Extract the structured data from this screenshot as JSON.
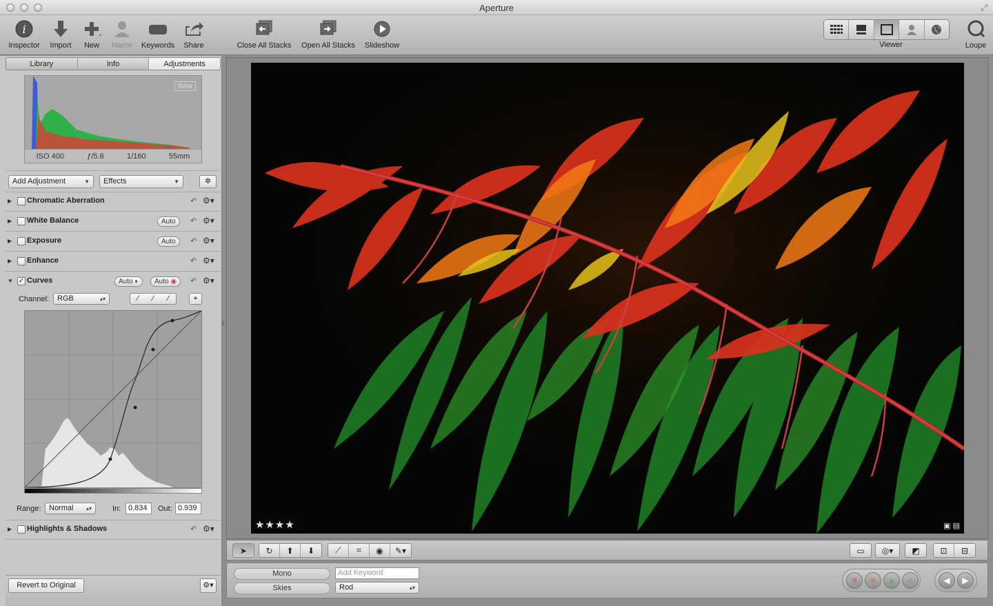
{
  "window": {
    "title": "Aperture"
  },
  "toolbar": {
    "inspector": "Inspector",
    "import": "Import",
    "new": "New",
    "name": "Name",
    "keywords": "Keywords",
    "share": "Share",
    "close_all_stacks": "Close All Stacks",
    "open_all_stacks": "Open All Stacks",
    "slideshow": "Slideshow",
    "viewer": "Viewer",
    "loupe": "Loupe"
  },
  "inspector": {
    "tabs": [
      {
        "label": "Library"
      },
      {
        "label": "Info"
      },
      {
        "label": "Adjustments"
      }
    ],
    "histogram": {
      "badge": "RAW",
      "iso": "ISO 400",
      "aperture": "ƒ/5.6",
      "shutter": "1/160",
      "focal": "55mm"
    },
    "add_adjustment": "Add Adjustment",
    "effects": "Effects",
    "adjustments": [
      {
        "label": "Chromatic Aberration"
      },
      {
        "label": "White Balance",
        "auto": "Auto"
      },
      {
        "label": "Exposure",
        "auto": "Auto"
      },
      {
        "label": "Enhance"
      },
      {
        "label": "Curves",
        "auto1": "Auto",
        "auto2": "Auto"
      }
    ],
    "curves": {
      "channel_label": "Channel:",
      "channel_value": "RGB",
      "range_label": "Range:",
      "range_value": "Normal",
      "in_label": "In:",
      "in_value": "0.834",
      "out_label": "Out:",
      "out_value": "0.939"
    },
    "highlights_shadows": "Highlights & Shadows",
    "revert": "Revert to Original"
  },
  "photo": {
    "stars": "★★★★"
  },
  "controls": {
    "preset1": "Mono",
    "preset2": "Skies",
    "keyword_placeholder": "Add Keyword",
    "keyword_value": "Rod"
  },
  "colors": {
    "reject": "#d65a4c",
    "down": "#d67a5a",
    "up": "#5bb15b",
    "accept": "#5bb15b"
  }
}
